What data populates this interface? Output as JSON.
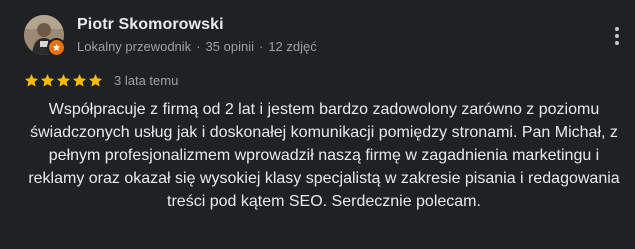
{
  "reviewer": {
    "name": "Piotr Skomorowski",
    "role": "Lokalny przewodnik",
    "reviews_count": "35 opinii",
    "photos_count": "12 zdjęć",
    "separator": "·",
    "badge_color": "#e8710a"
  },
  "rating": {
    "value": 5,
    "max": 5,
    "star_color": "#fbbc04",
    "time_ago": "3 lata temu"
  },
  "review": {
    "text": "Współpracuje z firmą od 2 lat i jestem bardzo zadowolony zarówno z poziomu świadczonych usług jak i doskonałej komunikacji pomiędzy stronami. Pan Michał, z pełnym profesjonalizmem wprowadził naszą firmę w zagadnienia marketingu i reklamy oraz okazał się wysokiej klasy specjalistą w zakresie pisania i redagowania treści pod kątem SEO. Serdecznie polecam."
  },
  "icons": {
    "more": "more-vert-icon",
    "star": "star-icon",
    "badge": "local-guide-badge-icon"
  },
  "theme": {
    "background": "#202124",
    "text_primary": "#e8eaed",
    "text_secondary": "#9aa0a6"
  }
}
